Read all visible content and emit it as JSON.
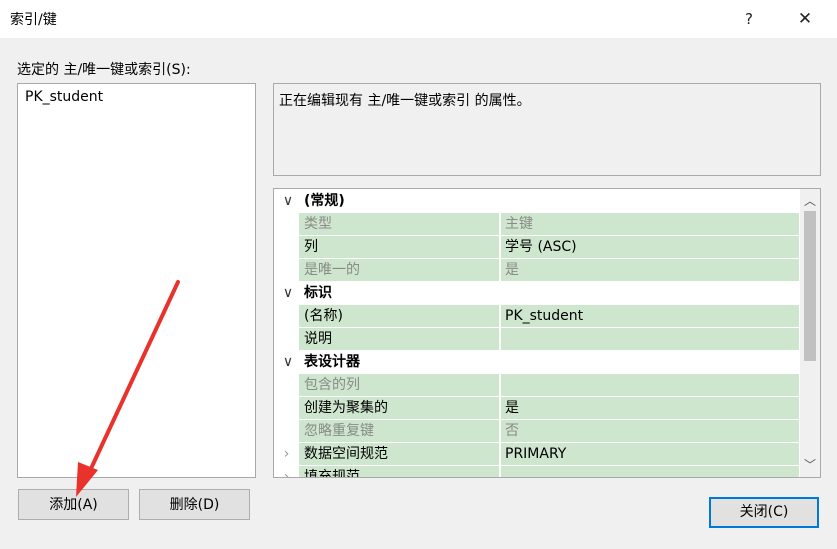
{
  "window": {
    "title": "索引/键",
    "help_glyph": "?",
    "close_glyph": "✕"
  },
  "left_panel": {
    "label": "选定的 主/唯一键或索引(S):",
    "items": [
      "PK_student"
    ]
  },
  "description": "正在编辑现有 主/唯一键或索引 的属性。",
  "properties": {
    "categories": [
      {
        "name": "(常规)",
        "rows": [
          {
            "name": "类型",
            "value": "主键",
            "disabled": true
          },
          {
            "name": "列",
            "value": "学号 (ASC)",
            "disabled": false
          },
          {
            "name": "是唯一的",
            "value": "是",
            "disabled": true
          }
        ]
      },
      {
        "name": "标识",
        "rows": [
          {
            "name": "(名称)",
            "value": "PK_student",
            "disabled": false
          },
          {
            "name": "说明",
            "value": "",
            "disabled": false
          }
        ]
      },
      {
        "name": "表设计器",
        "rows": [
          {
            "name": "包含的列",
            "value": "",
            "disabled": true
          },
          {
            "name": "创建为聚集的",
            "value": "是",
            "disabled": false
          },
          {
            "name": "忽略重复键",
            "value": "否",
            "disabled": true
          },
          {
            "name": "数据空间规范",
            "value": "PRIMARY",
            "disabled": false,
            "expandable": true
          },
          {
            "name": "填充规范",
            "value": "",
            "disabled": false,
            "expandable": true
          }
        ]
      }
    ]
  },
  "buttons": {
    "add": "添加(A)",
    "delete": "删除(D)",
    "close": "关闭(C)"
  },
  "annotation_color": "#e8322b"
}
